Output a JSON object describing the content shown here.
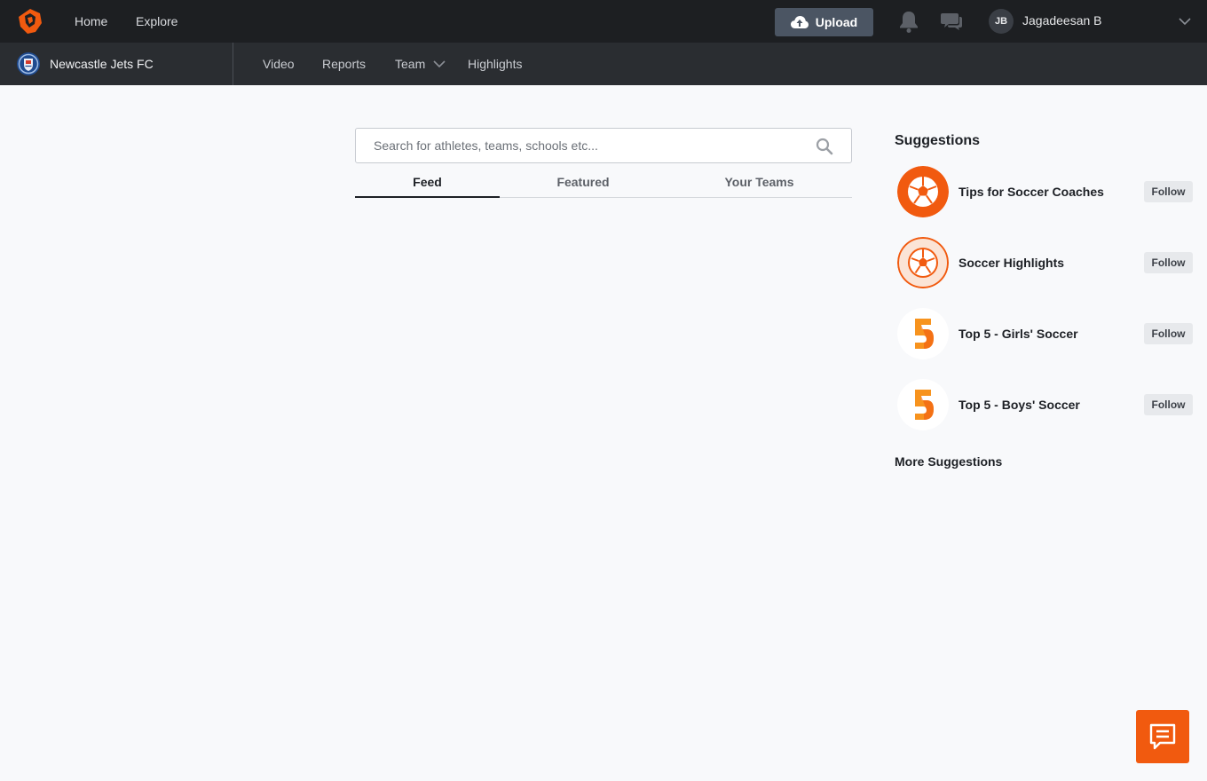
{
  "topbar": {
    "nav": [
      "Home",
      "Explore"
    ],
    "upload_label": "Upload",
    "user": {
      "initials": "JB",
      "name": "Jagadeesan B"
    }
  },
  "subbar": {
    "team_name": "Newcastle Jets FC",
    "nav": [
      "Video",
      "Reports",
      "Team",
      "Highlights"
    ]
  },
  "search": {
    "placeholder": "Search for athletes, teams, schools etc..."
  },
  "tabs": [
    "Feed",
    "Featured",
    "Your Teams"
  ],
  "active_tab": "Feed",
  "suggestions": {
    "title": "Suggestions",
    "items": [
      {
        "name": "Tips for Soccer Coaches",
        "follow_label": "Follow",
        "icon": "soccer-ball-icon"
      },
      {
        "name": "Soccer Highlights",
        "follow_label": "Follow",
        "icon": "soccer-ball-icon"
      },
      {
        "name": "Top 5 - Girls' Soccer",
        "follow_label": "Follow",
        "icon": "top-five-icon"
      },
      {
        "name": "Top 5 - Boys' Soccer",
        "follow_label": "Follow",
        "icon": "top-five-icon"
      }
    ],
    "more_label": "More Suggestions"
  },
  "colors": {
    "brand": "#f15a0f",
    "topbar": "#1d1f22",
    "subbar": "#2a2d31",
    "upload_button": "#4b5563"
  }
}
